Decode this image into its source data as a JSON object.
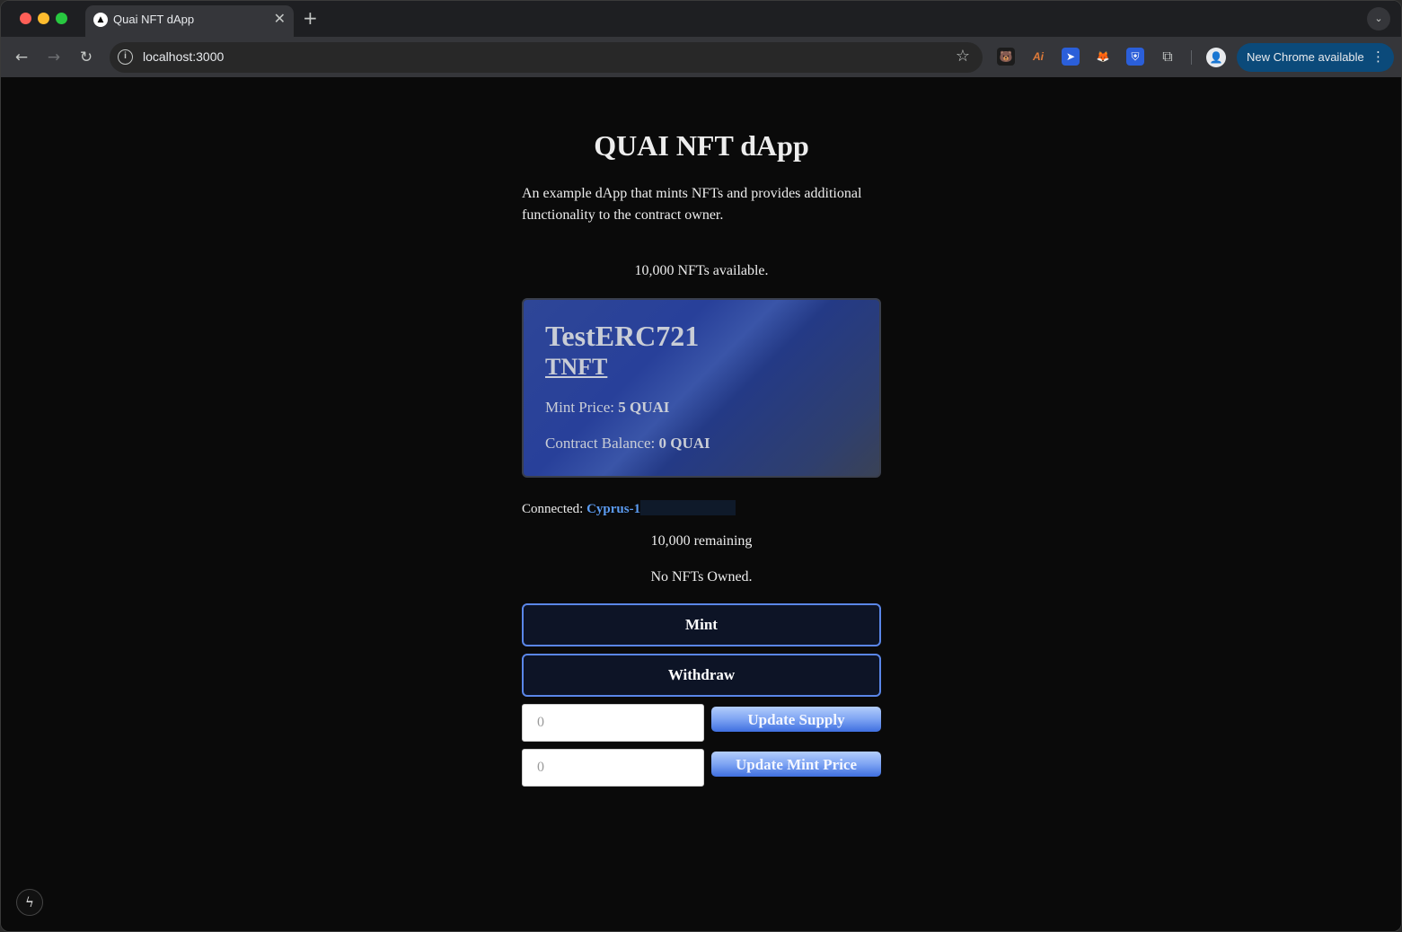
{
  "browser": {
    "tab": {
      "title": "Quai NFT dApp",
      "favicon_icon": "triangle-icon",
      "close_glyph": "✕"
    },
    "new_tab_glyph": "+",
    "tab_search_glyph": "⌄",
    "nav": {
      "back_glyph": "←",
      "forward_glyph": "→",
      "reload_glyph": "↻"
    },
    "address": {
      "url": "localhost:3000",
      "info_glyph": "i",
      "star_glyph": "☆"
    },
    "extensions": [
      {
        "name": "bear-extension-icon",
        "glyph": "🐻"
      },
      {
        "name": "ai-extension-icon",
        "glyph": "Ai"
      },
      {
        "name": "arrow-extension-icon",
        "glyph": "➤"
      },
      {
        "name": "fox-extension-icon",
        "glyph": "🦊"
      },
      {
        "name": "shield-extension-icon",
        "glyph": "⛨"
      },
      {
        "name": "puzzle-extensions-icon",
        "glyph": "⧉"
      }
    ],
    "profile_glyph": "👤",
    "update_label": "New Chrome available",
    "update_menu_glyph": "⋮"
  },
  "app": {
    "title": "QUAI NFT dApp",
    "description": "An example dApp that mints NFTs and provides additional functionality to the contract owner.",
    "available_text": "10,000 NFTs available.",
    "card": {
      "name": "TestERC721",
      "symbol": "TNFT",
      "mint_price_label": "Mint Price: ",
      "mint_price_value": "5 QUAI",
      "balance_label": "Contract Balance: ",
      "balance_value": "0 QUAI"
    },
    "connected_label": "Connected: ",
    "connected_shard": "Cyprus-1",
    "remaining_text": "10,000 remaining",
    "owned_text": "No NFTs Owned.",
    "mint_label": "Mint",
    "withdraw_label": "Withdraw",
    "supply_input": {
      "placeholder": "0"
    },
    "supply_button_label": "Update Supply",
    "price_input": {
      "placeholder": "0"
    },
    "price_button_label": "Update Mint Price",
    "next_badge_glyph": "ϟ"
  },
  "colors": {
    "page_background": "#0a0a0a",
    "accent_link": "#5b9bf0",
    "button_border": "#5a86e8",
    "update_pill": "#0b4a7a"
  }
}
